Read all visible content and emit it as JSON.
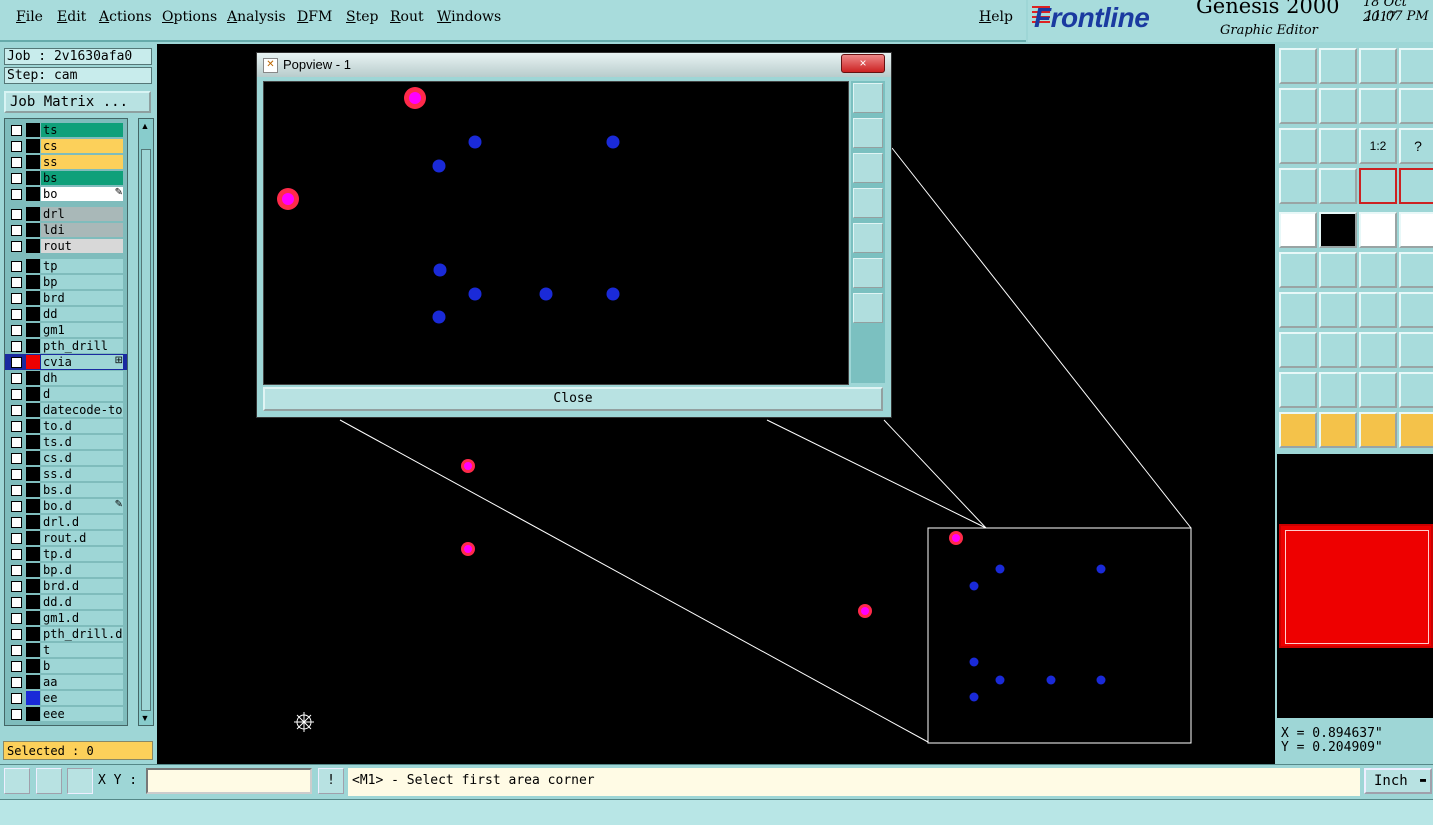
{
  "menu": {
    "items": [
      "File",
      "Edit",
      "Actions",
      "Options",
      "Analysis",
      "DFM",
      "Step",
      "Rout",
      "Windows"
    ],
    "help": "Help"
  },
  "brand": {
    "logo": "Frontline",
    "product": "Genesis 2000",
    "subtitle": "Graphic Editor",
    "date": "18 Oct 2017",
    "time": "11:07 PM"
  },
  "job": {
    "job_label": "Job : 2v1630afa0",
    "step_label": "Step: cam",
    "matrix_button": "Job Matrix ..."
  },
  "layers": [
    {
      "name": "ts",
      "color": "#0fa07a",
      "bg": "#0fa07a"
    },
    {
      "name": "cs",
      "color": "#000",
      "bg": "#fcd05a"
    },
    {
      "name": "ss",
      "color": "#000",
      "bg": "#fcd05a"
    },
    {
      "name": "bs",
      "color": "#000",
      "bg": "#0fa07a"
    },
    {
      "name": "bo",
      "color": "#000",
      "bg": "#ffffff",
      "mark": "✎"
    },
    {
      "name": "drl",
      "color": "#000",
      "bg": "#a9b8b8"
    },
    {
      "name": "ldi",
      "color": "#000",
      "bg": "#a9b8b8"
    },
    {
      "name": "rout",
      "color": "#000",
      "bg": "#d8d8d8"
    },
    {
      "name": "tp",
      "color": "#000",
      "bg": "#9ed6d6"
    },
    {
      "name": "bp",
      "color": "#000",
      "bg": "#9ed6d6"
    },
    {
      "name": "brd",
      "color": "#000",
      "bg": "#9ed6d6"
    },
    {
      "name": "dd",
      "color": "#000",
      "bg": "#9ed6d6"
    },
    {
      "name": "gm1",
      "color": "#000",
      "bg": "#9ed6d6"
    },
    {
      "name": "pth_drill",
      "color": "#000",
      "bg": "#9ed6d6"
    },
    {
      "name": "cvia",
      "color": "#000",
      "bg": "#9ed6d6",
      "swatch": "#e00",
      "active": true,
      "mark": "⊞"
    },
    {
      "name": "dh",
      "color": "#000",
      "bg": "#9ed6d6"
    },
    {
      "name": "d",
      "color": "#000",
      "bg": "#9ed6d6"
    },
    {
      "name": "datecode-to",
      "color": "#000",
      "bg": "#9ed6d6"
    },
    {
      "name": "to.d",
      "color": "#000",
      "bg": "#9ed6d6"
    },
    {
      "name": "ts.d",
      "color": "#000",
      "bg": "#9ed6d6"
    },
    {
      "name": "cs.d",
      "color": "#000",
      "bg": "#9ed6d6"
    },
    {
      "name": "ss.d",
      "color": "#000",
      "bg": "#9ed6d6"
    },
    {
      "name": "bs.d",
      "color": "#000",
      "bg": "#9ed6d6"
    },
    {
      "name": "bo.d",
      "color": "#000",
      "bg": "#9ed6d6",
      "mark": "✎"
    },
    {
      "name": "drl.d",
      "color": "#000",
      "bg": "#9ed6d6"
    },
    {
      "name": "rout.d",
      "color": "#000",
      "bg": "#9ed6d6"
    },
    {
      "name": "tp.d",
      "color": "#000",
      "bg": "#9ed6d6"
    },
    {
      "name": "bp.d",
      "color": "#000",
      "bg": "#9ed6d6"
    },
    {
      "name": "brd.d",
      "color": "#000",
      "bg": "#9ed6d6"
    },
    {
      "name": "dd.d",
      "color": "#000",
      "bg": "#9ed6d6"
    },
    {
      "name": "gm1.d",
      "color": "#000",
      "bg": "#9ed6d6"
    },
    {
      "name": "pth_drill.d",
      "color": "#000",
      "bg": "#9ed6d6"
    },
    {
      "name": "t",
      "color": "#000",
      "bg": "#9ed6d6"
    },
    {
      "name": "b",
      "color": "#000",
      "bg": "#9ed6d6"
    },
    {
      "name": "aa",
      "color": "#000",
      "bg": "#9ed6d6"
    },
    {
      "name": "ee",
      "color": "#000",
      "bg": "#9ed6d6",
      "swatch": "#1a2ad8"
    },
    {
      "name": "eee",
      "color": "#000",
      "bg": "#9ed6d6"
    }
  ],
  "selected": "Selected : 0",
  "popview": {
    "title": "Popview - 1",
    "close_x": "×",
    "close_button": "Close"
  },
  "coords": {
    "x": "X = 0.894637\"",
    "y": "Y = 0.204909\""
  },
  "bottom": {
    "xy_label": "X Y :",
    "xy_value": "",
    "exclaim": "!",
    "prompt": "<M1> - Select first area corner",
    "units": "Inch"
  },
  "colors": {
    "pad_magenta": "#ff00ff",
    "pad_ring": "#ff2a4a",
    "via_blue": "#1a2ad8",
    "canvas_bg": "#000000"
  }
}
